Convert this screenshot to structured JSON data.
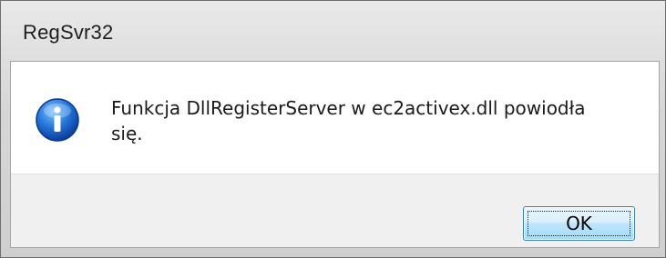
{
  "window": {
    "title": "RegSvr32"
  },
  "dialog": {
    "icon": "information-icon",
    "message": "Funkcja DllRegisterServer w ec2activex.dll powiodła się.",
    "ok_label": "OK"
  },
  "colors": {
    "frame": "#d7d7d7",
    "footer": "#f0f0f0",
    "button_border": "#3c7fb1",
    "icon_blue": "#1f6fd6"
  }
}
